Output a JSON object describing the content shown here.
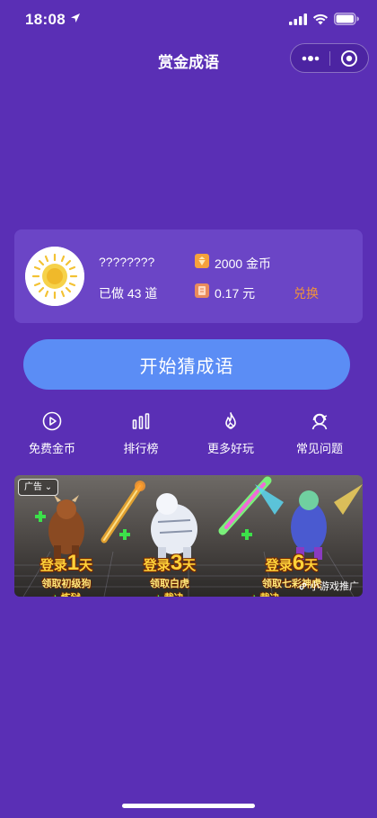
{
  "status_bar": {
    "time": "18:08"
  },
  "nav": {
    "title": "赏金成语"
  },
  "user": {
    "name": "????????",
    "done_prefix": "已做",
    "done_count": "43",
    "done_suffix": "道",
    "coins": "2000 金币",
    "cash": "0.17 元",
    "exchange_label": "兑换"
  },
  "start_button_label": "开始猜成语",
  "menu": [
    {
      "label": "免费金币",
      "icon": "play-circle-icon"
    },
    {
      "label": "排行榜",
      "icon": "bar-chart-icon"
    },
    {
      "label": "更多好玩",
      "icon": "flame-icon"
    },
    {
      "label": "常见问题",
      "icon": "support-agent-icon"
    }
  ],
  "ad": {
    "tag": "广告",
    "promos": [
      {
        "login_prefix": "登录",
        "days": "1",
        "login_suffix": "天",
        "reward": "领取初级狗",
        "bonus": "炼狱"
      },
      {
        "login_prefix": "登录",
        "days": "3",
        "login_suffix": "天",
        "reward": "领取白虎",
        "bonus": "裁决"
      },
      {
        "login_prefix": "登录",
        "days": "6",
        "login_suffix": "天",
        "reward": "领取七彩神虎",
        "bonus": "裁决"
      }
    ],
    "mini_game_label": "小游戏推广"
  },
  "colors": {
    "background": "#5a2fb5",
    "card": "#6b45c6",
    "primary_button": "#5b8df5",
    "exchange": "#f0933a"
  }
}
